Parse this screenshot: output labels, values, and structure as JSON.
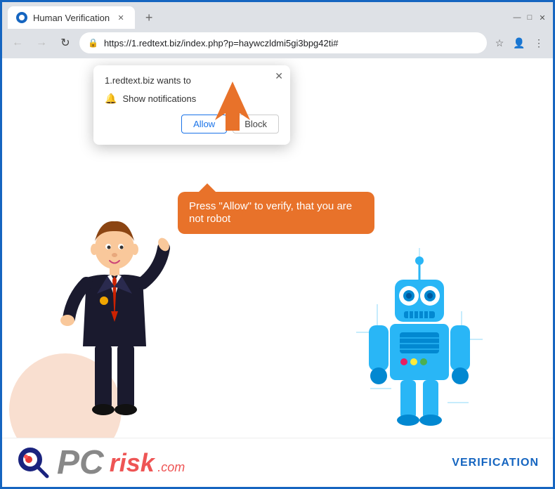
{
  "browser": {
    "title": "Human Verification",
    "url": "https://1.redtext.biz/index.php?p=haywczldmi5gi3bpg42ti#",
    "new_tab_symbol": "+",
    "back_symbol": "←",
    "forward_symbol": "→",
    "reload_symbol": "↻",
    "lock_symbol": "🔒",
    "minimize_symbol": "—",
    "maximize_symbol": "□",
    "close_symbol": "✕"
  },
  "popup": {
    "title": "1.redtext.biz wants to",
    "close_symbol": "✕",
    "notification_label": "Show notifications",
    "allow_label": "Allow",
    "block_label": "Block"
  },
  "speech_bubble": {
    "text": "Press \"Allow\" to verify, that you are not robot"
  },
  "footer": {
    "logo_pc": "PC",
    "logo_risk": "risk",
    "logo_com": ".com",
    "verification": "VERIFICATION"
  },
  "colors": {
    "blue_border": "#1565c0",
    "orange": "#e8722a",
    "allow_blue": "#1a73e8",
    "robot_blue": "#00bcd4",
    "verification_blue": "#1565c0"
  }
}
